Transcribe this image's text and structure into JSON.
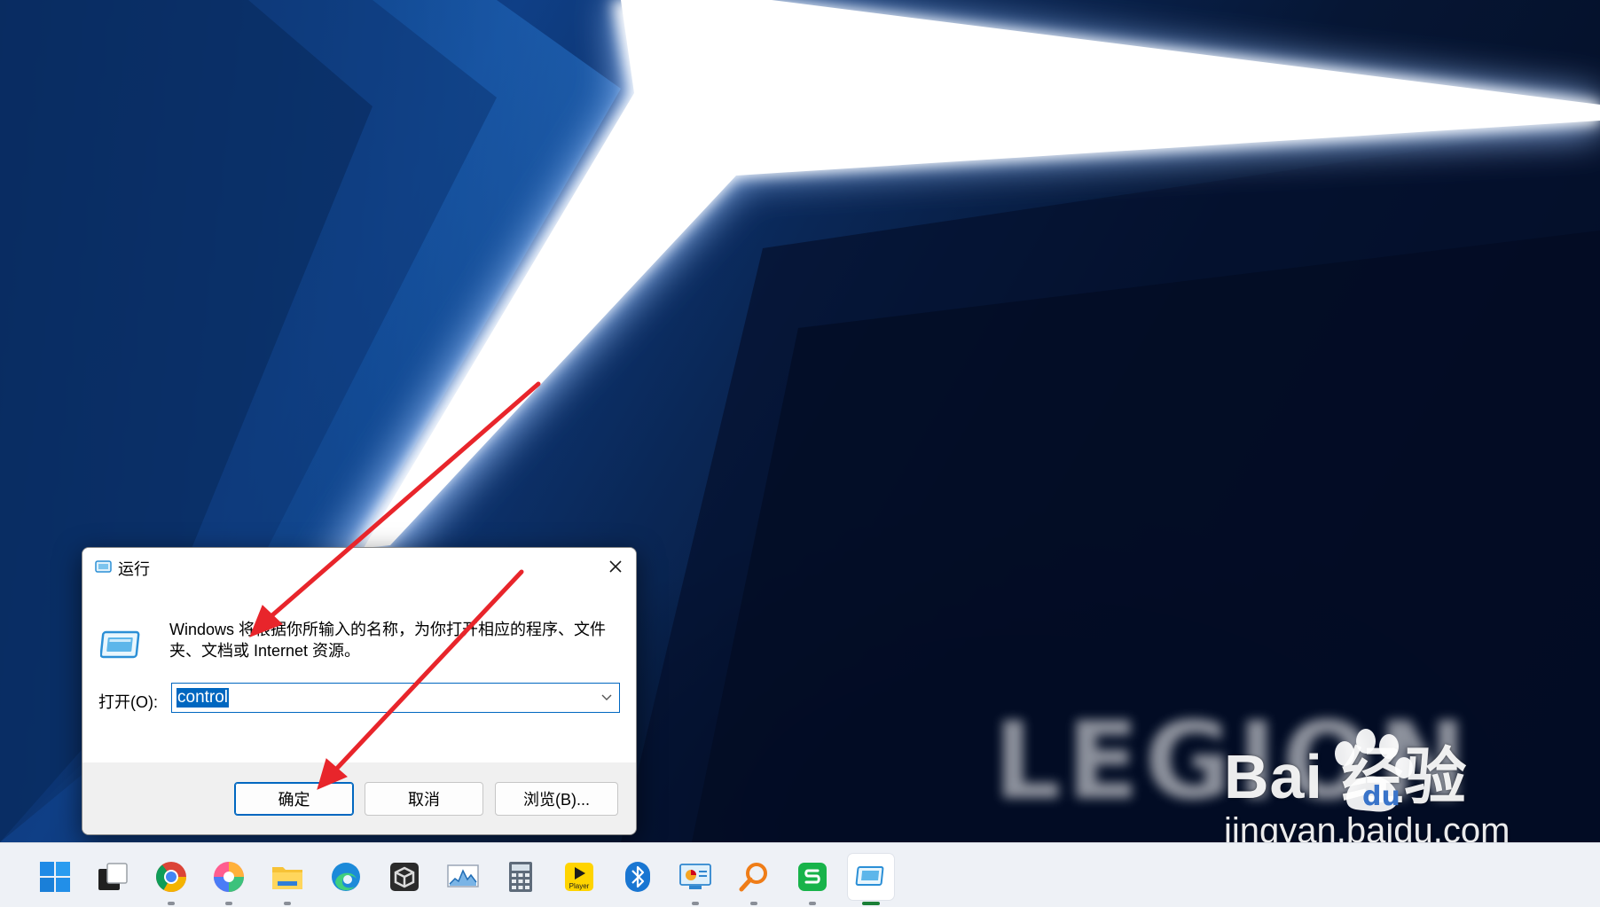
{
  "dialog": {
    "title": "运行",
    "description": "Windows 将根据你所输入的名称，为你打开相应的程序、文件夹、文档或 Internet 资源。",
    "open_label": "打开(O):",
    "command_value": "control",
    "ok_label": "确定",
    "cancel_label": "取消",
    "browse_label": "浏览(B)..."
  },
  "wallpaper": {
    "logo_text": "LEGION"
  },
  "watermark": {
    "brand": "Bai  经验",
    "url": "jingyan.baidu.com"
  },
  "taskbar": {
    "icons": [
      {
        "name": "start-icon",
        "running": false
      },
      {
        "name": "task-view-icon",
        "running": false
      },
      {
        "name": "chrome-icon",
        "running": true
      },
      {
        "name": "color-wheel-app-icon",
        "running": true
      },
      {
        "name": "file-explorer-icon",
        "running": true
      },
      {
        "name": "edge-icon",
        "running": false
      },
      {
        "name": "virtualbox-icon",
        "running": false
      },
      {
        "name": "performance-monitor-icon",
        "running": false
      },
      {
        "name": "calculator-icon",
        "running": false
      },
      {
        "name": "player-icon",
        "running": false
      },
      {
        "name": "bluetooth-icon",
        "running": false
      },
      {
        "name": "control-panel-icon",
        "running": true
      },
      {
        "name": "search-magnifier-icon",
        "running": true
      },
      {
        "name": "wps-icon",
        "running": true
      },
      {
        "name": "run-icon",
        "running": true,
        "active": true
      }
    ],
    "player_label": "Player"
  },
  "colors": {
    "accent": "#0067c0",
    "arrow": "#e8252b",
    "taskbar": "#eef1f6"
  }
}
